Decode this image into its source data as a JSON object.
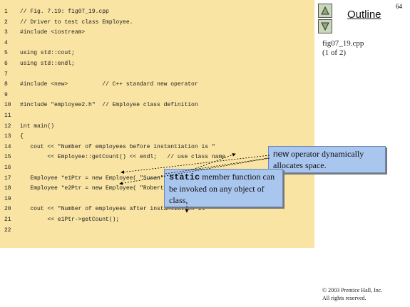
{
  "page_number": "64",
  "outline": {
    "title": "Outline",
    "file_name": "fig07_19.cpp",
    "part": "(1 of 2)",
    "up_icon": "triangle-up-icon",
    "down_icon": "triangle-down-icon"
  },
  "code": [
    {
      "n": "1",
      "text": "// Fig. 7.19: fig07_19.cpp"
    },
    {
      "n": "2",
      "text": "// Driver to test class Employee."
    },
    {
      "n": "3",
      "text": "#include <iostream>"
    },
    {
      "n": "4",
      "text": ""
    },
    {
      "n": "5",
      "text": "using std::cout;"
    },
    {
      "n": "6",
      "text": "using std::endl;"
    },
    {
      "n": "7",
      "text": ""
    },
    {
      "n": "8",
      "text": "#include <new>          // C++ standard new operator"
    },
    {
      "n": "9",
      "text": ""
    },
    {
      "n": "10",
      "text": "#include \"employee2.h\"  // Employee class definition"
    },
    {
      "n": "11",
      "text": ""
    },
    {
      "n": "12",
      "text": "int main()"
    },
    {
      "n": "13",
      "text": "{"
    },
    {
      "n": "14",
      "text": "   cout << \"Number of employees before instantiation is \""
    },
    {
      "n": "15",
      "text": "        << Employee::getCount() << endl;   // use class name"
    },
    {
      "n": "16",
      "text": ""
    },
    {
      "n": "17",
      "text": "   Employee *e1Ptr = new Employee( \"Susan\", \"Baker\" );"
    },
    {
      "n": "18",
      "text": "   Employee *e2Ptr = new Employee( \"Robert\", \"Jones\" );"
    },
    {
      "n": "19",
      "text": ""
    },
    {
      "n": "20",
      "text": "   cout << \"Number of employees after instantiation is \""
    },
    {
      "n": "21",
      "text": "        << e1Ptr->getCount();"
    },
    {
      "n": "22",
      "text": ""
    }
  ],
  "callout_new": {
    "keyword": "new",
    "text": " operator dynamically allocates space."
  },
  "callout_static": {
    "keyword": "static",
    "text": " member function can be invoked on any object of class."
  },
  "copyright": {
    "line1": "© 2003 Prentice Hall, Inc.",
    "line2": "All rights reserved."
  }
}
